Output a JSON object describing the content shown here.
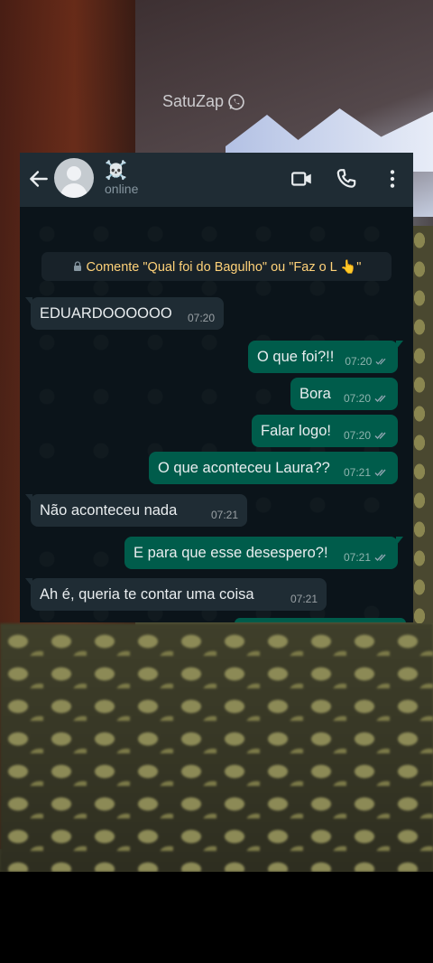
{
  "watermark": {
    "text": "SatuZap",
    "icon": "whatsapp-icon"
  },
  "header": {
    "contact_name": "☠️",
    "status": "online",
    "icons": [
      "back-arrow-icon",
      "avatar",
      "video-call-icon",
      "voice-call-icon",
      "more-vert-icon"
    ]
  },
  "system_message": {
    "icon": "lock-icon",
    "text": "Comente \"Qual foi do Bagulho\" ou \"Faz o L 👆\""
  },
  "messages": [
    {
      "direction": "in",
      "text": "EDUARDOOOOOO",
      "time": "07:20"
    },
    {
      "direction": "out",
      "text": "O que foi?!!",
      "time": "07:20",
      "status": "read-ticks"
    },
    {
      "direction": "out",
      "text": "Bora",
      "time": "07:20",
      "status": "read-ticks"
    },
    {
      "direction": "out",
      "text": "Falar logo!",
      "time": "07:20",
      "status": "read-ticks"
    },
    {
      "direction": "out",
      "text": "O que aconteceu Laura??",
      "time": "07:21",
      "status": "read-ticks"
    },
    {
      "direction": "in",
      "text": "Não aconteceu nada",
      "time": "07:21"
    },
    {
      "direction": "out",
      "text": "E para que esse desespero?!",
      "time": "07:21",
      "status": "read-ticks"
    },
    {
      "direction": "in",
      "text": "Ah é, queria te contar uma coisa",
      "time": "07:21"
    }
  ],
  "colors": {
    "incoming_bubble": "#1f2c34",
    "outgoing_bubble": "#005c4b",
    "chat_background": "#0b141a",
    "header_background": "#1f2c34",
    "system_text": "#ffd279"
  }
}
